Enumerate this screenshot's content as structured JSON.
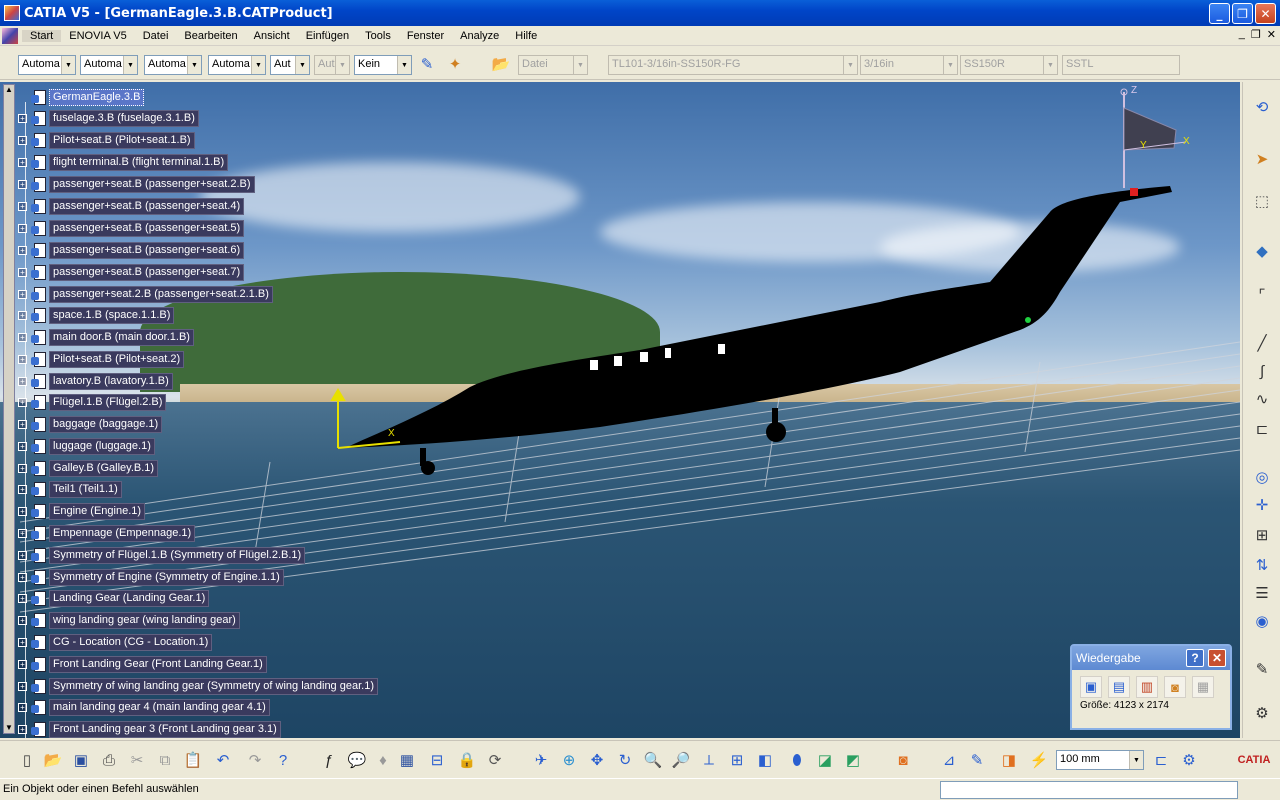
{
  "window": {
    "title": "CATIA V5 - [GermanEagle.3.B.CATProduct]",
    "min": "_",
    "restore": "❐",
    "close": "✕"
  },
  "menu": {
    "items": [
      "Start",
      "ENOVIA V5",
      "Datei",
      "Bearbeiten",
      "Ansicht",
      "Einfügen",
      "Tools",
      "Fenster",
      "Analyze",
      "Hilfe"
    ],
    "mdi": {
      "min": "_",
      "restore": "❐",
      "close": "✕"
    }
  },
  "toolbar1": {
    "combos": [
      "Automa",
      "Automa",
      "Automa",
      "Automa",
      "Aut",
      "Aut",
      "Kein"
    ],
    "file_combo": "Datei",
    "material_combo": "TL101-3/16in-SS150R-FG",
    "thickness_combo": "3/16in",
    "spec_combo": "SS150R",
    "type_combo": "SSTL"
  },
  "tree": {
    "root": "GermanEagle.3.B",
    "nodes": [
      "fuselage.3.B (fuselage.3.1.B)",
      "Pilot+seat.B (Pilot+seat.1.B)",
      "flight terminal.B (flight terminal.1.B)",
      "passenger+seat.B (passenger+seat.2.B)",
      "passenger+seat.B (passenger+seat.4)",
      "passenger+seat.B (passenger+seat.5)",
      "passenger+seat.B (passenger+seat.6)",
      "passenger+seat.B (passenger+seat.7)",
      "passenger+seat.2.B (passenger+seat.2.1.B)",
      "space.1.B (space.1.1.B)",
      "main door.B (main door.1.B)",
      "Pilot+seat.B (Pilot+seat.2)",
      "lavatory.B (lavatory.1.B)",
      "Flügel.1.B (Flügel.2.B)",
      "baggage (baggage.1)",
      "luggage (luggage.1)",
      "Galley.B (Galley.B.1)",
      "Teil1 (Teil1.1)",
      "Engine (Engine.1)",
      "Empennage (Empennage.1)",
      "Symmetry of Flügel.1.B (Symmetry of Flügel.2.B.1)",
      "Symmetry of Engine (Symmetry of Engine.1.1)",
      "Landing Gear (Landing Gear.1)",
      "wing landing gear (wing landing gear)",
      "CG - Location (CG - Location.1)",
      "Front Landing Gear (Front Landing Gear.1)",
      "Symmetry of wing landing gear (Symmetry of wing landing gear.1)",
      "main landing gear 4 (main landing gear 4.1)",
      "Front Landing gear 3 (Front Landing gear 3.1)"
    ]
  },
  "axes": {
    "x": "X",
    "y": "Y",
    "z": "Z"
  },
  "wiedergabe": {
    "title": "Wiedergabe",
    "help": "?",
    "close": "✕",
    "size": "Größe: 4123 x 2174"
  },
  "bottom_toolbar": {
    "unit_combo": "100 mm"
  },
  "statusbar": {
    "message": "Ein Objekt oder einen Befehl auswählen"
  },
  "colors": {
    "title_blue": "#0045c8",
    "tree_label_bg": "#3a3a5e",
    "axis_yellow": "#e8e000"
  }
}
